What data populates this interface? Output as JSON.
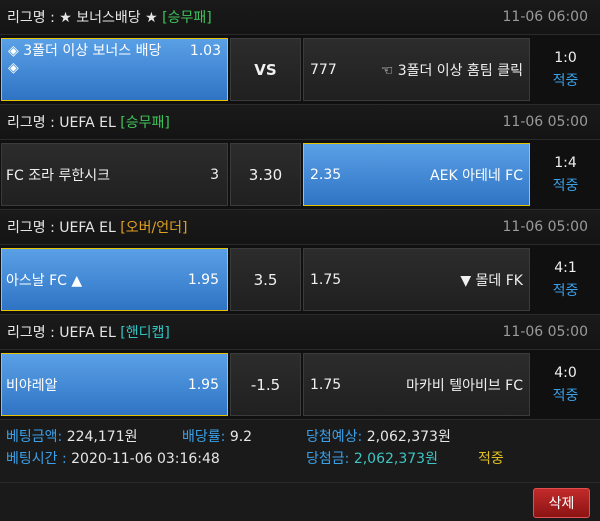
{
  "league_prefix": "리그명 : ",
  "bets": [
    {
      "league": "★ 보너스배당 ★",
      "tag": "[승무패]",
      "time": "11-06 06:00",
      "home": "◈ 3폴더 이상 보너스 배당",
      "home_tail": "◈",
      "home_odds": "1.03",
      "mid": "VS",
      "away_odds": "777",
      "away": "☜ 3폴더 이상 홈팀 클릭",
      "score": "1:0",
      "status": "적중"
    },
    {
      "league": "UEFA EL",
      "tag": "[승무패]",
      "time": "11-06 05:00",
      "home": "FC 조라 루한시크",
      "home_odds": "3",
      "mid": "3.30",
      "away_odds": "2.35",
      "away": "AEK 아테네 FC",
      "score": "1:4",
      "status": "적중"
    },
    {
      "league": "UEFA EL",
      "tag": "[오버/언더]",
      "time": "11-06 05:00",
      "home": "아스날 FC ▲",
      "home_odds": "1.95",
      "mid": "3.5",
      "away_odds": "1.75",
      "away": "▼ 몰데 FK",
      "score": "4:1",
      "status": "적중"
    },
    {
      "league": "UEFA EL",
      "tag": "[핸디캡]",
      "time": "11-06 05:00",
      "home": "비야레알",
      "home_odds": "1.95",
      "mid": "-1.5",
      "away_odds": "1.75",
      "away": "마카비 텔아비브 FC",
      "score": "4:0",
      "status": "적중"
    }
  ],
  "summary": {
    "bet_amount_label": "베팅금액:",
    "bet_amount": "224,171원",
    "odds_label": "배당률:",
    "odds": "9.2",
    "expected_label": "당첨예상:",
    "expected": "2,062,373원",
    "bet_time_label": "베팅시간 :",
    "bet_time": "2020-11-06 03:16:48",
    "win_label": "당첨금:",
    "win_amount": "2,062,373원",
    "result": "적중"
  },
  "delete_label": "삭제",
  "colors": {
    "selected_bg": "#3d86d6",
    "selected_border": "#e5c200",
    "hit_blue": "#3aa0e8",
    "tag_green": "#3fc35a",
    "tag_orange": "#e0a020",
    "tag_teal": "#33c3c3",
    "delete_red": "#b02020"
  }
}
